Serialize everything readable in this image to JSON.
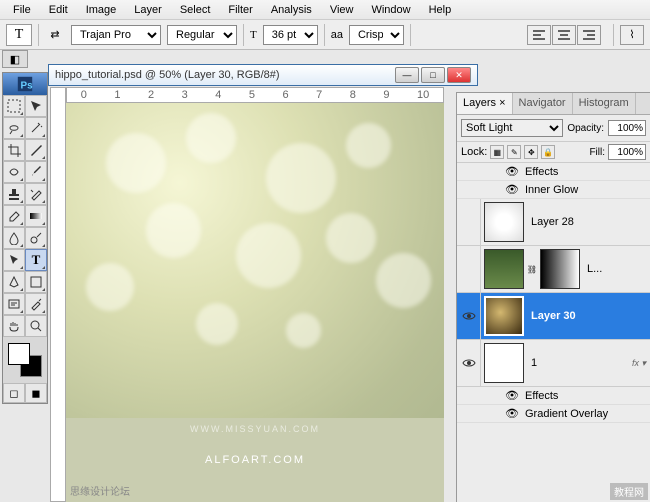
{
  "menu": {
    "items": [
      "File",
      "Edit",
      "Image",
      "Layer",
      "Select",
      "Filter",
      "Analysis",
      "View",
      "Window",
      "Help"
    ]
  },
  "options": {
    "font_family": "Trajan Pro",
    "font_style": "Regular",
    "font_size": "36 pt",
    "aa_label": "aa",
    "aa_value": "Crisp"
  },
  "document": {
    "title": "hippo_tutorial.psd @ 50% (Layer 30, RGB/8#)",
    "ruler_marks": [
      "0",
      "1",
      "2",
      "3",
      "4",
      "5",
      "6",
      "7",
      "8",
      "9",
      "10"
    ]
  },
  "canvas": {
    "watermark_main": "ALFOART.COM",
    "watermark_sub": "WWW.MISSYUAN.COM",
    "corner_cn": "思缘设计论坛",
    "bottom_right": "教程网"
  },
  "panel": {
    "tabs": [
      "Layers",
      "Navigator",
      "Histogram"
    ],
    "active_tab": 0,
    "blend_mode": "Soft Light",
    "opacity_label": "Opacity:",
    "opacity_value": "100%",
    "lock_label": "Lock:",
    "fill_label": "Fill:",
    "fill_value": "100%",
    "effects_label": "Effects",
    "inner_glow": "Inner Glow",
    "gradient_overlay": "Gradient Overlay",
    "layers": [
      {
        "name": "Layer 28",
        "visible": false,
        "selected": false,
        "thumb": "white-blur"
      },
      {
        "name": "L...",
        "visible": false,
        "selected": false,
        "thumb": "green-foliage",
        "mask": true
      },
      {
        "name": "Layer 30",
        "visible": true,
        "selected": true,
        "thumb": "dark-bokeh"
      },
      {
        "name": "1",
        "visible": true,
        "selected": false,
        "thumb": "white",
        "fx": true
      }
    ]
  },
  "tools": {
    "list": [
      "move",
      "marquee",
      "lasso",
      "wand",
      "crop",
      "slice",
      "healing",
      "brush",
      "stamp",
      "history-brush",
      "eraser",
      "gradient",
      "blur",
      "dodge",
      "pen",
      "type",
      "path-select",
      "shape",
      "notes",
      "eyedropper",
      "hand",
      "zoom"
    ],
    "active": "type"
  }
}
